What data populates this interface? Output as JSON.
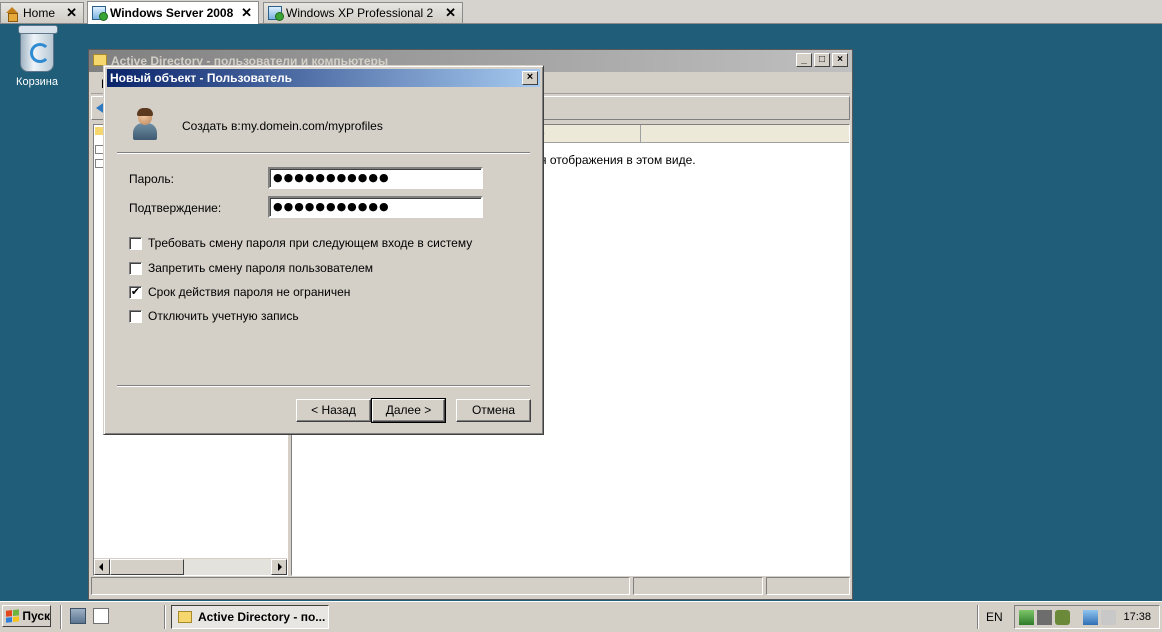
{
  "vm_tabs": [
    {
      "label": "Home",
      "icon": "home-icon",
      "active": false
    },
    {
      "label": "Windows Server 2008",
      "icon": "vm-icon",
      "active": true
    },
    {
      "label": "Windows XP Professional 2",
      "icon": "vm-icon",
      "active": false
    }
  ],
  "desktop": {
    "recycle_bin_label": "Корзина"
  },
  "background_window": {
    "title": "Active Directory - пользователи и компьютеры",
    "menu_first_letter": "К",
    "column_header_fragment": "е",
    "list_message_fragment": "я отображения в этом виде.",
    "controls": {
      "minimize": "_",
      "maximize": "□",
      "close": "×"
    }
  },
  "dialog": {
    "title": "Новый объект - Пользователь",
    "close_glyph": "×",
    "create_in_label": "Создать в:",
    "create_in_path": "my.domein.com/myprofiles",
    "password_label": "Пароль:",
    "password_value": "●●●●●●●●●●●",
    "confirm_label": "Подтверждение:",
    "confirm_value": "●●●●●●●●●●●",
    "options": [
      {
        "label": "Требовать смену пароля при следующем входе в систему",
        "checked": false
      },
      {
        "label": "Запретить смену пароля пользователем",
        "checked": false
      },
      {
        "label": "Срок действия пароля не ограничен",
        "checked": true
      },
      {
        "label": "Отключить учетную запись",
        "checked": false
      }
    ],
    "buttons": {
      "back": "< Назад",
      "next": "Далее >",
      "cancel": "Отмена"
    }
  },
  "taskbar": {
    "start_label": "Пуск",
    "task_button_label": "Active Directory - по...",
    "language": "EN",
    "clock": "17:38"
  },
  "colors": {
    "desktop": "#1f5d78",
    "dialog_title_start": "#0a246a",
    "dialog_title_end": "#a6caf0",
    "window_face": "#d4d0c8"
  }
}
